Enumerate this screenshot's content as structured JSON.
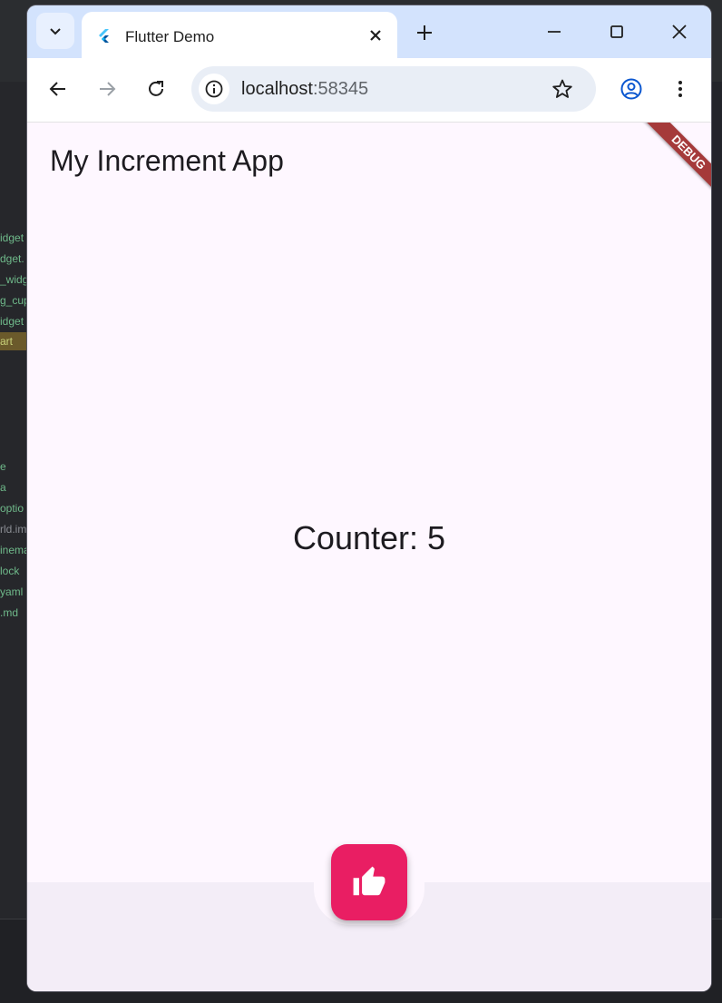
{
  "ide": {
    "files": [
      {
        "label": "idget"
      },
      {
        "label": "dget."
      },
      {
        "label": "_widg"
      },
      {
        "label": "g_cup"
      },
      {
        "label": "idget"
      },
      {
        "label": "art"
      },
      {
        "label": "e"
      },
      {
        "label": "a"
      },
      {
        "label": "optio"
      },
      {
        "label": "rld.im"
      },
      {
        "label": "inema"
      },
      {
        "label": "lock"
      },
      {
        "label": "yaml"
      },
      {
        "label": ".md"
      }
    ]
  },
  "browser": {
    "tab_title": "Flutter Demo",
    "url_host": "localhost",
    "url_port": ":58345",
    "icons": {
      "tab_search": "chevron-down-icon",
      "favicon": "flutter-logo-icon",
      "close_tab": "close-icon",
      "new_tab": "plus-icon",
      "minimize": "minimize-icon",
      "maximize": "maximize-icon",
      "close_window": "close-icon",
      "back": "back-arrow-icon",
      "forward": "forward-arrow-icon",
      "reload": "reload-icon",
      "site_info": "info-icon",
      "bookmark": "star-icon",
      "profile": "profile-icon",
      "menu": "more-vertical-icon"
    }
  },
  "app": {
    "title": "My Increment App",
    "debug_banner": "DEBUG",
    "counter_text": "Counter: 5",
    "fab_icon": "thumb-up-icon",
    "colors": {
      "background": "#fef7ff",
      "bottom_bar": "#f3edf7",
      "fab": "#e91e63",
      "debug_banner": "#a53a3a"
    }
  }
}
